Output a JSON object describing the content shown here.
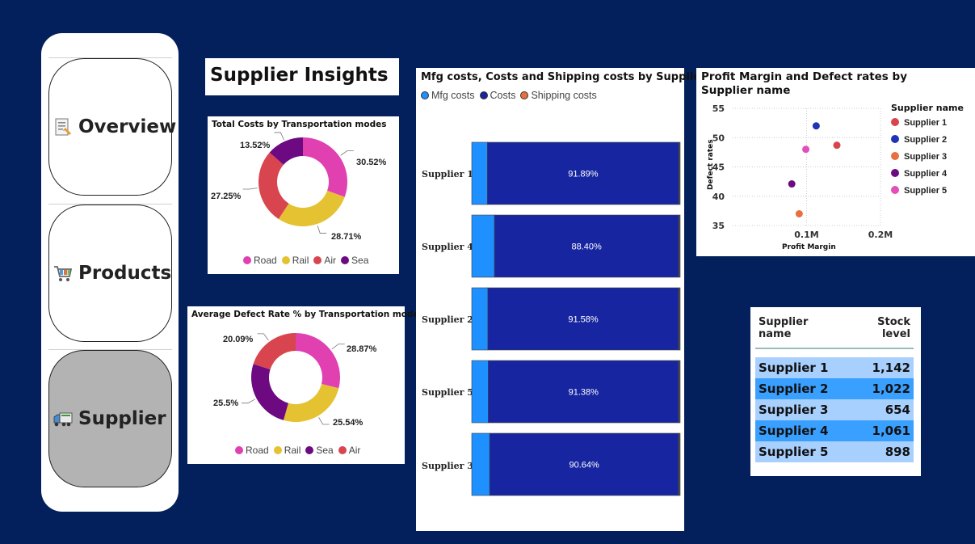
{
  "nav": {
    "items": [
      {
        "label": "Overview",
        "icon": "document-icon"
      },
      {
        "label": "Products",
        "icon": "shopping-cart-icon"
      },
      {
        "label": "Supplier",
        "icon": "truck-icon",
        "active": true
      }
    ]
  },
  "page_title": "Supplier Insights",
  "colors": {
    "background": "#03205c",
    "road": "#e040b0",
    "rail": "#e5c231",
    "air": "#d8454e",
    "sea": "#6d0a82",
    "mfg": "#1e90ff",
    "costs": "#1726a0",
    "shipping": "#e8703e"
  },
  "chart_data": [
    {
      "type": "pie",
      "variant": "donut",
      "title": "Total Costs by Transportation modes",
      "categories": [
        "Road",
        "Rail",
        "Air",
        "Sea"
      ],
      "values": [
        30.52,
        28.71,
        27.25,
        13.52
      ],
      "labels": [
        "30.52%",
        "28.71%",
        "27.25%",
        "13.52%"
      ],
      "legend": "bottom"
    },
    {
      "type": "pie",
      "variant": "donut",
      "title": "Average Defect Rate % by Transportation modes",
      "categories": [
        "Road",
        "Rail",
        "Sea",
        "Air"
      ],
      "values": [
        28.87,
        25.54,
        25.5,
        20.09
      ],
      "labels": [
        "28.87%",
        "25.54%",
        "25.5%",
        "20.09%"
      ],
      "legend": "bottom"
    },
    {
      "type": "bar",
      "orientation": "horizontal",
      "stacked": "100%",
      "title": "Mfg costs, Costs and Shipping costs by Supplier...",
      "categories": [
        "Supplier 1",
        "Supplier 4",
        "Supplier 2",
        "Supplier 5",
        "Supplier 3"
      ],
      "series": [
        {
          "name": "Mfg costs",
          "values": [
            7.5,
            10.9,
            7.7,
            7.9,
            8.6
          ]
        },
        {
          "name": "Costs",
          "values": [
            91.89,
            88.4,
            91.58,
            91.38,
            90.64
          ],
          "labels": [
            "91.89%",
            "88.40%",
            "91.58%",
            "91.38%",
            "90.64%"
          ]
        },
        {
          "name": "Shipping costs",
          "values": [
            0.61,
            0.7,
            0.72,
            0.72,
            0.76
          ]
        }
      ],
      "legend": "top-left"
    },
    {
      "type": "scatter",
      "title": "Profit Margin and Defect rates by Supplier name",
      "xlabel": "Profit Margin",
      "ylabel": "Defect rates",
      "xlim": [
        0,
        0.2
      ],
      "ylim": [
        35,
        55
      ],
      "xticks": [
        "0.1M",
        "0.2M"
      ],
      "xtick_values": [
        0.1,
        0.2
      ],
      "yticks": [
        35,
        40,
        45,
        50,
        55
      ],
      "legend_title": "Supplier name",
      "legend": "right",
      "series": [
        {
          "name": "Supplier 1",
          "x": 0.141,
          "y": 48.7
        },
        {
          "name": "Supplier 2",
          "x": 0.113,
          "y": 52
        },
        {
          "name": "Supplier 3",
          "x": 0.09,
          "y": 37
        },
        {
          "name": "Supplier 4",
          "x": 0.08,
          "y": 42.1
        },
        {
          "name": "Supplier 5",
          "x": 0.099,
          "y": 48
        }
      ],
      "grid": true
    },
    {
      "type": "table",
      "columns": [
        "Supplier name",
        "Stock level"
      ],
      "rows": [
        [
          "Supplier 1",
          "1,142"
        ],
        [
          "Supplier 2",
          "1,022"
        ],
        [
          "Supplier 3",
          "654"
        ],
        [
          "Supplier 4",
          "1,061"
        ],
        [
          "Supplier 5",
          "898"
        ]
      ]
    }
  ]
}
